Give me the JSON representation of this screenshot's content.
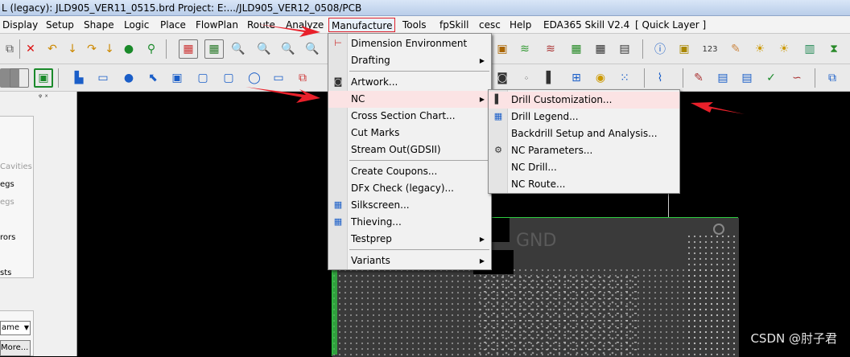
{
  "window": {
    "title": "L (legacy): JLD905_VER11_0515.brd  Project: E:.../JLD905_VER12_0508/PCB"
  },
  "menubar": {
    "items": [
      "Display",
      "Setup",
      "Shape",
      "Logic",
      "Place",
      "FlowPlan",
      "Route",
      "Analyze",
      "Manufacture",
      "Tools",
      "fpSkill",
      "cesc",
      "Help",
      "EDA365 Skill V2.4",
      "[ Quick Layer ]"
    ],
    "active": "Manufacture"
  },
  "manufacture_menu": {
    "items": [
      {
        "label": "Dimension Environment",
        "icon": "dimension-icon"
      },
      {
        "label": "Drafting",
        "submenu": true
      },
      {
        "label": "Artwork...",
        "icon": "artwork-icon"
      },
      {
        "label": "NC",
        "submenu": true,
        "highlighted": true
      },
      {
        "label": "Cross Section Chart..."
      },
      {
        "label": "Cut Marks"
      },
      {
        "label": "Stream Out(GDSII)"
      },
      {
        "label": "Create Coupons..."
      },
      {
        "label": "DFx Check (legacy)..."
      },
      {
        "label": "Silkscreen...",
        "icon": "silkscreen-icon"
      },
      {
        "label": "Thieving...",
        "icon": "thieving-icon"
      },
      {
        "label": "Testprep",
        "submenu": true
      },
      {
        "label": "Variants",
        "submenu": true
      }
    ]
  },
  "nc_submenu": {
    "items": [
      {
        "label": "Drill Customization...",
        "highlighted": true,
        "icon": "drill-customization-icon"
      },
      {
        "label": "Drill Legend...",
        "icon": "drill-legend-icon"
      },
      {
        "label": "Backdrill Setup and Analysis..."
      },
      {
        "label": "NC Parameters...",
        "icon": "nc-parameters-icon"
      },
      {
        "label": "NC Drill..."
      },
      {
        "label": "NC Route..."
      }
    ]
  },
  "left_panel": {
    "pin": "ᵠ ˣ",
    "items": [
      "Cavities",
      "egs",
      "egs",
      "rors",
      "sts"
    ],
    "dropdown_value": "ame",
    "button_label": "More..."
  },
  "canvas": {
    "board_label": "GND"
  },
  "watermark": "CSDN @肘子君",
  "colors": {
    "highlight_border": "#e0202a",
    "menu_hover": "#fbe3e4",
    "annotation_arrow": "#e8202a",
    "board_outline": "#2ecc40"
  }
}
